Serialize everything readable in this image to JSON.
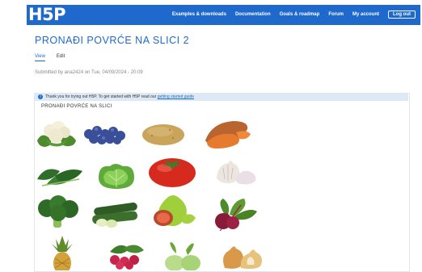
{
  "header": {
    "logo": "H5P",
    "nav": [
      "Examples & downloads",
      "Documentation",
      "Goals & roadmap",
      "Forum",
      "My account"
    ],
    "login_button": "Log out"
  },
  "page": {
    "title": "PRONAĐI POVRĆE NA SLICI 2",
    "tabs": [
      "View",
      "Edit"
    ],
    "submitted": "Submitted by ana2424 on Tue, 04/09/2024 - 20:09"
  },
  "notice": {
    "text": "Thank you for trying out H5P. To get started with H5P read our",
    "link": "getting started guide"
  },
  "task": {
    "title": "PRONAĐI POVRĆE NA SLICI"
  },
  "items": [
    "cauliflower-image",
    "blueberries-image",
    "potato-image",
    "sweet-potato-image",
    "spinach-image",
    "lettuce-image",
    "tomato-image",
    "garlic-image",
    "broccoli-image",
    "zucchini-image",
    "fig-image",
    "beetroot-image",
    "pineapple-image",
    "raspberries-image",
    "kohlrabi-image",
    "onion-image"
  ]
}
